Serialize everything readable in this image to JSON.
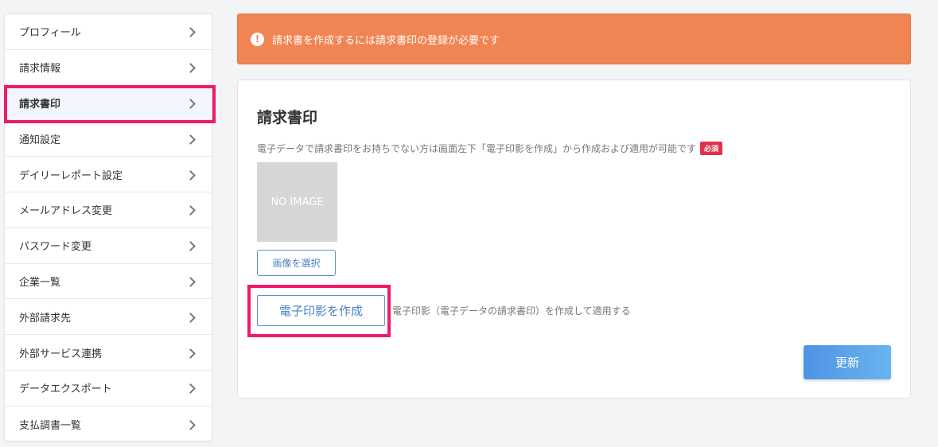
{
  "sidebar": {
    "items": [
      {
        "label": "プロフィール"
      },
      {
        "label": "請求情報"
      },
      {
        "label": "請求書印"
      },
      {
        "label": "通知設定"
      },
      {
        "label": "デイリーレポート設定"
      },
      {
        "label": "メールアドレス変更"
      },
      {
        "label": "パスワード変更"
      },
      {
        "label": "企業一覧"
      },
      {
        "label": "外部請求先"
      },
      {
        "label": "外部サービス連携"
      },
      {
        "label": "データエクスポート"
      },
      {
        "label": "支払調書一覧"
      }
    ],
    "active_index": 2
  },
  "alert": {
    "icon": "exclamation-icon",
    "text": "請求書を作成するには請求書印の登録が必要です",
    "color": "#f08553"
  },
  "panel": {
    "title": "請求書印",
    "description": "電子データで請求書印をお持ちでない方は画面左下「電子印影を作成」から作成および適用が可能です",
    "required_badge": "必須",
    "no_image_text": "NO IMAGE",
    "select_image_label": "画像を選択",
    "create_seal_label": "電子印影を作成",
    "create_seal_description": "電子印影（電子データの請求書印）を作成して適用する",
    "update_label": "更新"
  },
  "colors": {
    "highlight": "#ef1b6a",
    "accent_blue": "#4a82c6",
    "required_red": "#e3304b"
  }
}
